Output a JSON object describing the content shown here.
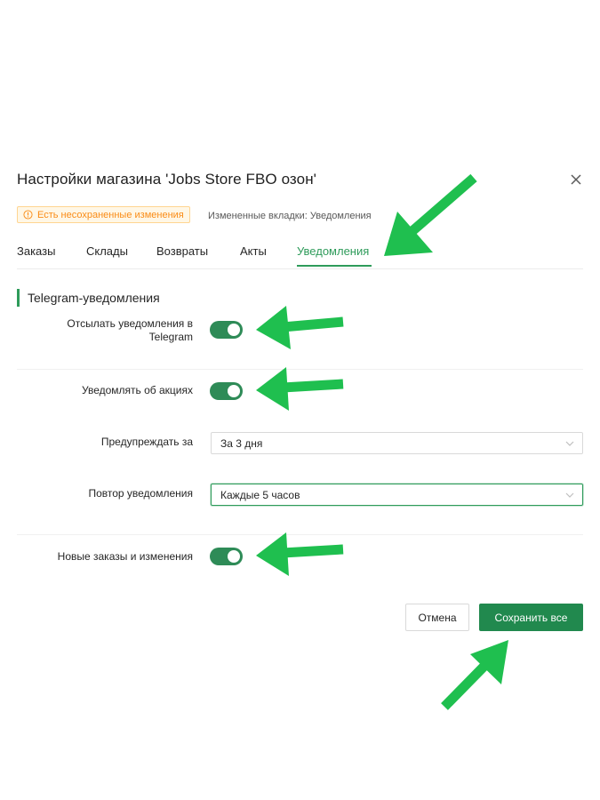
{
  "dialog": {
    "title": "Настройки магазина 'Jobs Store FBO озон'",
    "unsaved_badge": "Есть несохраненные изменения",
    "changed_tabs": "Измененные вкладки: Уведомления"
  },
  "tabs": [
    {
      "label": "Заказы"
    },
    {
      "label": "Склады"
    },
    {
      "label": "Возвраты"
    },
    {
      "label": "Акты"
    },
    {
      "label": "Уведомления",
      "active": true
    }
  ],
  "section": {
    "title": "Telegram-уведомления"
  },
  "settings": {
    "send_notifications": {
      "label": "Отсылать уведомления в Telegram",
      "enabled": true
    },
    "notify_promotions": {
      "label": "Уведомлять об акциях",
      "enabled": true
    },
    "warn_before": {
      "label": "Предупреждать за",
      "value": "За 3 дня"
    },
    "repeat_notification": {
      "label": "Повтор уведомления",
      "value": "Каждые 5 часов"
    },
    "new_orders": {
      "label": "Новые заказы и изменения",
      "enabled": true
    }
  },
  "buttons": {
    "cancel": "Отмена",
    "save": "Сохранить все"
  },
  "colors": {
    "accent": "#2e9b5a",
    "switch_on": "#2e8b57",
    "save_button": "#21894e",
    "warning": "#fa8c16",
    "annotation_arrow": "#1fbf4f"
  },
  "icons": {
    "close": "close-icon",
    "warning": "info-circle-icon",
    "select": "chevron-down-icon"
  }
}
